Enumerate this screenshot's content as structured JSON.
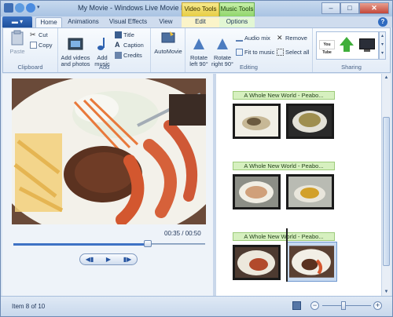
{
  "window": {
    "title": "My Movie - Windows Live Movie Maker",
    "contextual_tabs": {
      "video_tools": "Video Tools",
      "music_tools": "Music Tools"
    }
  },
  "tabs": {
    "file_label": "",
    "items": [
      "Home",
      "Animations",
      "Visual Effects",
      "View",
      "Edit",
      "Options"
    ],
    "active": "Home",
    "help_label": "?"
  },
  "ribbon": {
    "clipboard": {
      "label": "Clipboard",
      "paste": "Paste",
      "cut": "Cut",
      "copy": "Copy"
    },
    "add": {
      "label": "Add",
      "add_videos": "Add videos\nand photos",
      "add_music": "Add\nmusic",
      "title": "Title",
      "caption": "Caption",
      "credits": "Credits"
    },
    "automovie": {
      "label": "AutoMovie"
    },
    "editing": {
      "label": "Editing",
      "rotate_left": "Rotate\nleft 90°",
      "rotate_right": "Rotate\nright 90°",
      "audio_mix": "Audio mix",
      "fit_to_music": "Fit to music",
      "remove": "Remove",
      "select_all": "Select all"
    },
    "sharing": {
      "label": "Sharing",
      "youtube": "You Tube"
    }
  },
  "preview": {
    "timecode": "00:35 / 00:50",
    "progress": 0.7,
    "controls": {
      "prev": "◀▮",
      "play": "▶",
      "next": "▮▶"
    }
  },
  "storyboard": {
    "groups": [
      {
        "caption": "A Whole New World - Peabo..."
      },
      {
        "caption": "A Whole New World - Peabo..."
      },
      {
        "caption": "A Whole New World - Peabo..."
      }
    ]
  },
  "status": {
    "item_text": "Item 8 of 10",
    "zoom_minus": "−",
    "zoom_plus": "+"
  },
  "colors": {
    "accent": "#3e72c4",
    "caption_bg": "#d6f0bf",
    "video_tools": "#e7cd44",
    "music_tools": "#8fd56b"
  }
}
